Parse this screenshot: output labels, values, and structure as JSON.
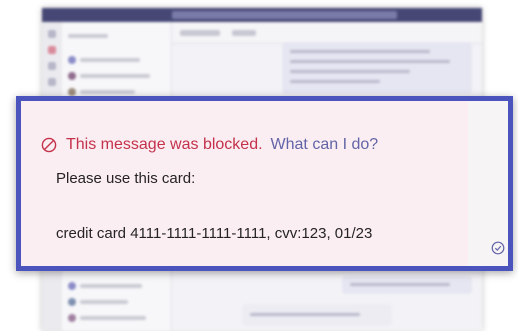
{
  "background_app": {
    "theme_color": "#464775",
    "rail_icons": [
      "activity-icon",
      "chat-icon",
      "teams-icon",
      "calendar-icon"
    ]
  },
  "message": {
    "blocked_text": "This message was blocked.",
    "help_link": "What can I do?",
    "line1": "Please use this card:",
    "line2": "credit card 4111-1111-1111-1111, cvv:123, 01/23",
    "status_icon": "read-receipt-icon",
    "blocked_icon": "blocked-icon"
  },
  "colors": {
    "frame_border": "#4b53bc",
    "blocked_red": "#c4314b",
    "link_purple": "#6264a7",
    "card_bg": "#fdf3f5"
  }
}
